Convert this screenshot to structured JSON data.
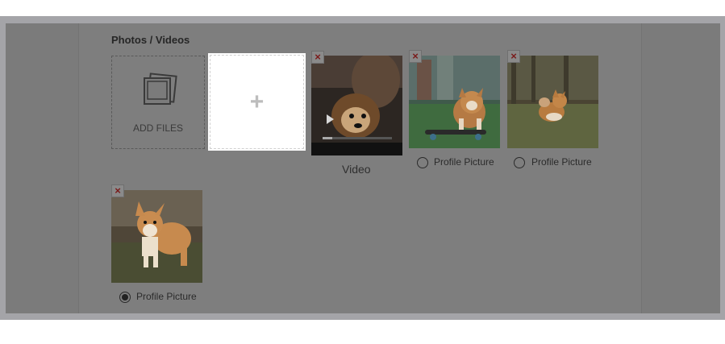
{
  "section": {
    "title": "Photos / Videos"
  },
  "add_files": {
    "label": "ADD FILES",
    "icon": "photos-stack-icon"
  },
  "drop_slot": {
    "symbol": "+"
  },
  "media": [
    {
      "kind": "video",
      "caption": "Video",
      "remove_symbol": "×"
    },
    {
      "kind": "photo",
      "radio_label": "Profile Picture",
      "selected": false,
      "remove_symbol": "×"
    },
    {
      "kind": "photo",
      "radio_label": "Profile Picture",
      "selected": false,
      "remove_symbol": "×"
    },
    {
      "kind": "photo",
      "radio_label": "Profile Picture",
      "selected": true,
      "remove_symbol": "×"
    }
  ],
  "colors": {
    "overlay": "#7b7b7b",
    "remove_x": "#7a1a1a",
    "slot_bg": "#ffffff"
  }
}
